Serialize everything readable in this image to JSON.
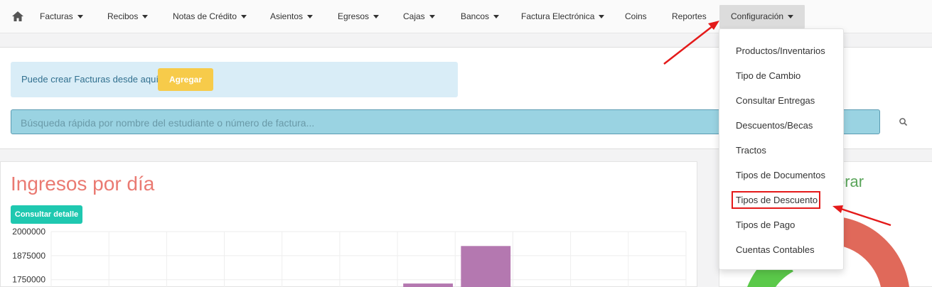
{
  "nav": {
    "items": [
      {
        "label": "Facturas",
        "caret": true
      },
      {
        "label": "Recibos",
        "caret": true
      },
      {
        "label": "Notas de Crédito",
        "caret": true
      },
      {
        "label": "Asientos",
        "caret": true
      },
      {
        "label": "Egresos",
        "caret": true
      },
      {
        "label": "Cajas",
        "caret": true
      },
      {
        "label": "Bancos",
        "caret": true
      },
      {
        "label": "Factura Electrónica",
        "caret": true
      },
      {
        "label": "Coins",
        "caret": false
      },
      {
        "label": "Reportes",
        "caret": false
      },
      {
        "label": "Configuración",
        "caret": true,
        "active": true
      }
    ]
  },
  "alert": {
    "text": "Puede crear Facturas desde aquí",
    "button": "Agregar"
  },
  "search": {
    "placeholder": "Búsqueda rápida por nombre del estudiante o número de factura..."
  },
  "panel_left": {
    "title": "Ingresos por día",
    "button": "Consultar detalle"
  },
  "panel_right": {
    "title_fragment": "orar"
  },
  "dropdown": {
    "items": [
      "Productos/Inventarios",
      "Tipo de Cambio",
      "Consultar Entregas",
      "Descuentos/Becas",
      "Tractos",
      "Tipos de Documentos",
      "Tipos de Descuento",
      "Tipos de Pago",
      "Cuentas Contables"
    ],
    "highlighted": "Tipos de Descuento"
  },
  "chart_data": {
    "type": "bar",
    "y_ticks": [
      "2000000",
      "1875000",
      "1750000"
    ],
    "ylim": [
      1675000,
      2000000
    ],
    "values": [
      1675000,
      1675000,
      1675000,
      1675000,
      1675000,
      1675000,
      1730000,
      1925000,
      1675000,
      1675000,
      1675000
    ],
    "bar_color": "#b478b0"
  },
  "colors": {
    "accent_red": "#e41a1a",
    "agregar": "#f7cb4a",
    "detalle": "#1fc8b0",
    "donut_red": "#e0695a",
    "donut_green": "#5bc94a"
  }
}
